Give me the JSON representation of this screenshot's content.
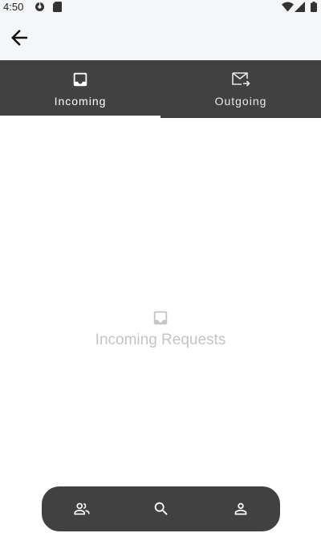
{
  "status_bar": {
    "time": "4:50"
  },
  "app_bar": {
    "back_icon": "arrow-back-icon"
  },
  "tabs": [
    {
      "label": "Incoming",
      "icon": "inbox-icon",
      "selected": true
    },
    {
      "label": "Outgoing",
      "icon": "mail-send-icon",
      "selected": false
    }
  ],
  "empty_state": {
    "icon": "inbox-icon",
    "text": "Incoming Requests"
  },
  "bottom_nav": {
    "items": [
      {
        "icon": "friends-icon"
      },
      {
        "icon": "search-icon"
      },
      {
        "icon": "profile-icon"
      }
    ]
  },
  "colors": {
    "app_bar_bg": "#f5f6f8",
    "tab_bar_bg": "#414141",
    "nav_bg": "#414141",
    "empty_text": "#c4c4c4"
  }
}
